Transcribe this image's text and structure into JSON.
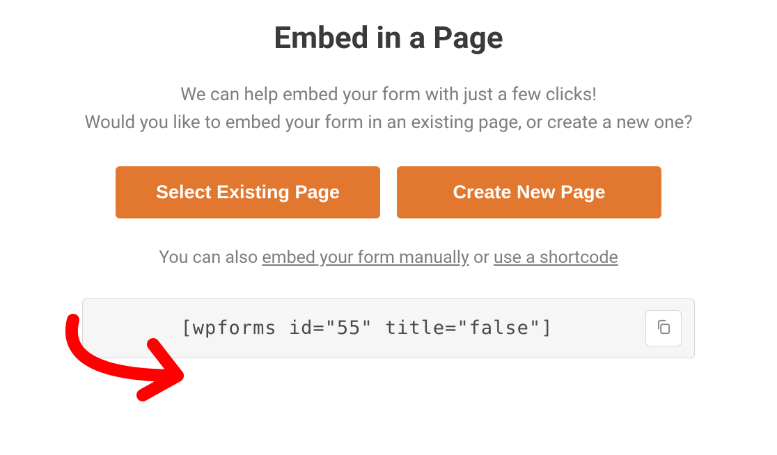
{
  "title": "Embed in a Page",
  "description": {
    "line1": "We can help embed your form with just a few clicks!",
    "line2": "Would you like to embed your form in an existing page, or create a new one?"
  },
  "buttons": {
    "existing": "Select Existing Page",
    "new": "Create New Page"
  },
  "altText": {
    "prefix": "You can also ",
    "link1": "embed your form manually",
    "mid": " or ",
    "link2": "use a shortcode"
  },
  "shortcode": "[wpforms id=\"55\" title=\"false\"]"
}
